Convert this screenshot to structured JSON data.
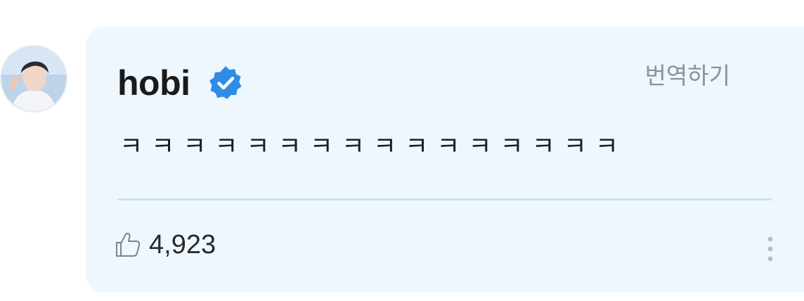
{
  "avatar": {
    "icon": "profile-photo"
  },
  "comment": {
    "author": "hobi",
    "verified_icon": "verified-badge-icon",
    "verified_color": "#2f8ce8",
    "translate_label": "번역하기",
    "text": "ㅋㅋㅋㅋㅋㅋㅋㅋㅋㅋㅋㅋㅋㅋㅋㅋ",
    "likes": "4,923",
    "like_icon": "thumbs-up-icon",
    "more_icon": "more-vertical-icon"
  },
  "colors": {
    "card_background": "#eef7fe",
    "divider": "#c9e4ee",
    "muted_text": "#8c9196"
  }
}
